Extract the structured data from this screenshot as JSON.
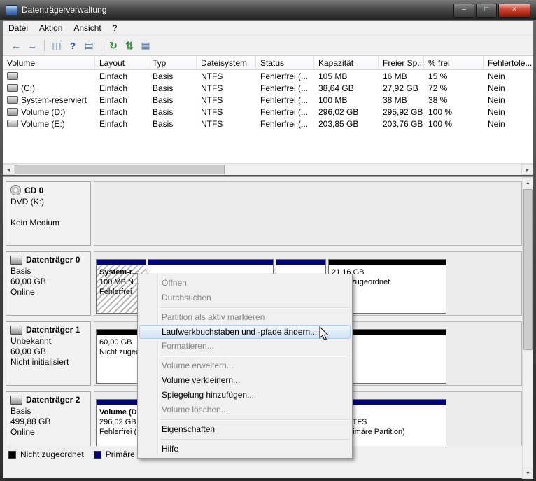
{
  "window": {
    "title": "Datenträgerverwaltung",
    "controls": {
      "minimize": "–",
      "maximize": "□",
      "close": "×"
    }
  },
  "menubar": {
    "items": [
      "Datei",
      "Aktion",
      "Ansicht",
      "?"
    ]
  },
  "toolbar": {
    "icons": [
      {
        "name": "back",
        "glyph": "←"
      },
      {
        "name": "forward",
        "glyph": "→"
      },
      {
        "name": "show-console-tree",
        "glyph": "◫"
      },
      {
        "name": "help",
        "glyph": "?"
      },
      {
        "name": "show-action-pane",
        "glyph": "▤"
      },
      {
        "name": "refresh",
        "glyph": "↻"
      },
      {
        "name": "rescan-disks",
        "glyph": "⇅"
      },
      {
        "name": "properties",
        "glyph": "▦"
      }
    ]
  },
  "volume_table": {
    "columns": [
      "Volume",
      "Layout",
      "Typ",
      "Dateisystem",
      "Status",
      "Kapazität",
      "Freier Sp...",
      "% frei",
      "Fehlertole..."
    ],
    "rows": [
      [
        "",
        "Einfach",
        "Basis",
        "NTFS",
        "Fehlerfrei (...",
        "105 MB",
        "16 MB",
        "15 %",
        "Nein"
      ],
      [
        "(C:)",
        "Einfach",
        "Basis",
        "NTFS",
        "Fehlerfrei (...",
        "38,64 GB",
        "27,92 GB",
        "72 %",
        "Nein"
      ],
      [
        "System-reserviert",
        "Einfach",
        "Basis",
        "NTFS",
        "Fehlerfrei (...",
        "100 MB",
        "38 MB",
        "38 %",
        "Nein"
      ],
      [
        "Volume (D:)",
        "Einfach",
        "Basis",
        "NTFS",
        "Fehlerfrei (...",
        "296,02 GB",
        "295,92 GB",
        "100 %",
        "Nein"
      ],
      [
        "Volume (E:)",
        "Einfach",
        "Basis",
        "NTFS",
        "Fehlerfrei (...",
        "203,85 GB",
        "203,76 GB",
        "100 %",
        "Nein"
      ]
    ]
  },
  "disks": [
    {
      "title": "CD 0",
      "lines": [
        "DVD (K:)",
        "",
        "Kein Medium"
      ]
    },
    {
      "title": "Datenträger 0",
      "lines": [
        "Basis",
        "60,00 GB",
        "Online"
      ],
      "partitions": [
        {
          "name": "System-r...",
          "size": "100 MB N...",
          "status": "Fehlerfrei"
        },
        {
          "name": "",
          "size": "",
          "status": ""
        },
        {
          "name": "",
          "size": "",
          "status": ""
        },
        {
          "name": "",
          "size": "21,16 GB",
          "status": "Nicht zugeordnet"
        }
      ]
    },
    {
      "title": "Datenträger 1",
      "lines": [
        "Unbekannt",
        "60,00 GB",
        "Nicht initialisiert"
      ],
      "partitions": [
        {
          "name": "",
          "size": "60,00 GB",
          "status": "Nicht zugeordnet"
        }
      ]
    },
    {
      "title": "Datenträger 2",
      "lines": [
        "Basis",
        "499,88 GB",
        "Online"
      ],
      "partitions": [
        {
          "name": "Volume (D:)",
          "size": "296,02 GB NTFS",
          "status": "Fehlerfrei (Primäre Partition)"
        },
        {
          "name": "Volume (E:)",
          "size": "203,85 GB NTFS",
          "status": "Fehlerfrei (Primäre Partition)"
        }
      ]
    }
  ],
  "legend": {
    "items": [
      {
        "label": "Nicht zugeordnet",
        "color": "#000000"
      },
      {
        "label": "Primäre Partition",
        "color": "#000082"
      }
    ]
  },
  "context_menu": {
    "items": [
      {
        "label": "Öffnen",
        "enabled": false
      },
      {
        "label": "Durchsuchen",
        "enabled": false
      },
      {
        "label": "Partition als aktiv markieren",
        "enabled": false
      },
      {
        "label": "Laufwerkbuchstaben und -pfade ändern...",
        "enabled": true,
        "highlighted": true
      },
      {
        "label": "Formatieren...",
        "enabled": false
      },
      {
        "label": "Volume erweitern...",
        "enabled": false
      },
      {
        "label": "Volume verkleinern...",
        "enabled": true
      },
      {
        "label": "Spiegelung hinzufügen...",
        "enabled": true
      },
      {
        "label": "Volume löschen...",
        "enabled": false
      },
      {
        "label": "Eigenschaften",
        "enabled": true
      },
      {
        "label": "Hilfe",
        "enabled": true
      }
    ]
  },
  "colors": {
    "primary_partition": "#000082",
    "unallocated": "#000000",
    "menu_highlight_border": "#aecff7"
  }
}
